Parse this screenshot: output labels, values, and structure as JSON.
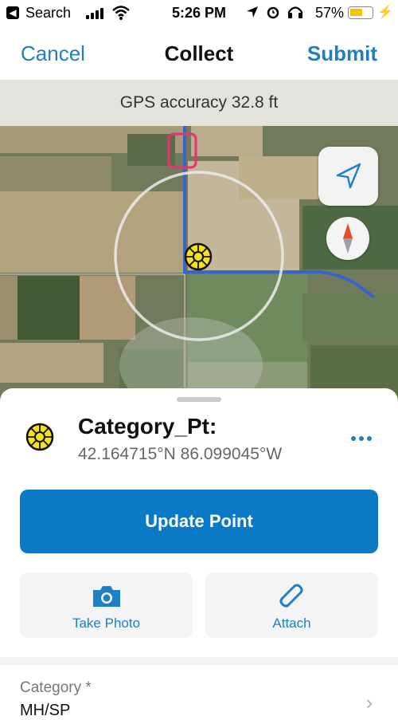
{
  "status_bar": {
    "back_label": "Search",
    "time": "5:26 PM",
    "battery_percent": "57%",
    "battery_level": 0.57,
    "battery_color": "#f5c400",
    "icons": [
      "back-arrow-icon",
      "signal-bars-icon",
      "wifi-icon",
      "location-arrow-icon",
      "alarm-icon",
      "headphones-icon",
      "battery-icon",
      "charging-bolt-icon"
    ]
  },
  "nav": {
    "cancel_label": "Cancel",
    "title": "Collect",
    "submit_label": "Submit",
    "accent_color": "#1f7fc4"
  },
  "gps": {
    "text": "GPS accuracy 32.8 ft"
  },
  "map": {
    "controls": [
      "my-location-icon",
      "compass-icon"
    ],
    "marker_icon": "point-marker-icon"
  },
  "feature": {
    "title": "Category_Pt:",
    "coordinates": "42.164715°N  86.099045°W",
    "more_icon": "ellipsis-icon"
  },
  "actions": {
    "update_label": "Update Point",
    "update_color": "#0a79c6",
    "take_photo_label": "Take Photo",
    "attach_label": "Attach"
  },
  "form": {
    "category_label": "Category *",
    "category_value": "MH/SP"
  }
}
